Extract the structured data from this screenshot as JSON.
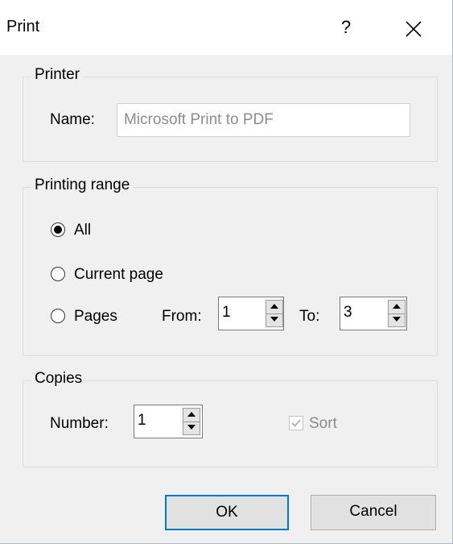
{
  "window": {
    "title": "Print",
    "help_glyph": "?"
  },
  "printer": {
    "group_label": "Printer",
    "name_label": "Name:",
    "name_value": "Microsoft Print to PDF"
  },
  "range": {
    "group_label": "Printing range",
    "options": [
      {
        "label": "All",
        "selected": true
      },
      {
        "label": "Current page",
        "selected": false
      },
      {
        "label": "Pages",
        "selected": false
      }
    ],
    "from_label": "From:",
    "from_value": "1",
    "to_label": "To:",
    "to_value": "3"
  },
  "copies": {
    "group_label": "Copies",
    "number_label": "Number:",
    "number_value": "1",
    "sort_label": "Sort",
    "sort_checked": true,
    "sort_enabled": false
  },
  "buttons": {
    "ok": "OK",
    "cancel": "Cancel"
  },
  "colors": {
    "accent": "#0078d7",
    "dialog_bg": "#f0f0f0",
    "disabled_text": "#8c8c8c"
  }
}
